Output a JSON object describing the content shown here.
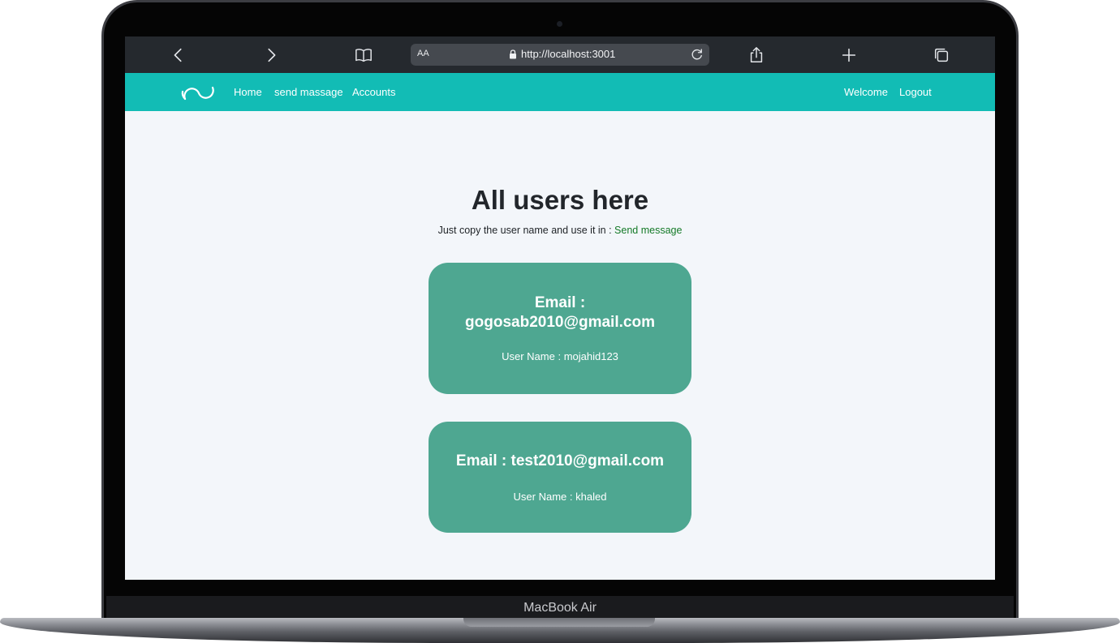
{
  "device": {
    "label": "MacBook Air"
  },
  "browser": {
    "address_aa": "AA",
    "url": "http://localhost:3001"
  },
  "navbar": {
    "left_links": [
      "Home",
      "send massage",
      "Accounts"
    ],
    "right_links": [
      "Welcome",
      "Logout"
    ],
    "background_color": "#12bcb5"
  },
  "main": {
    "title": "All users here",
    "subtitle_text": "Just copy the user name and use it in : ",
    "subtitle_link": "Send message",
    "users": [
      {
        "email_label": "Email :",
        "email": "gogosab2010@gmail.com",
        "username_label": "User Name :",
        "username": "mojahid123"
      },
      {
        "email_label": "Email :",
        "email": "test2010@gmail.com",
        "username_label": "User Name :",
        "username": "khaled"
      }
    ],
    "card_color": "#4ea791"
  }
}
